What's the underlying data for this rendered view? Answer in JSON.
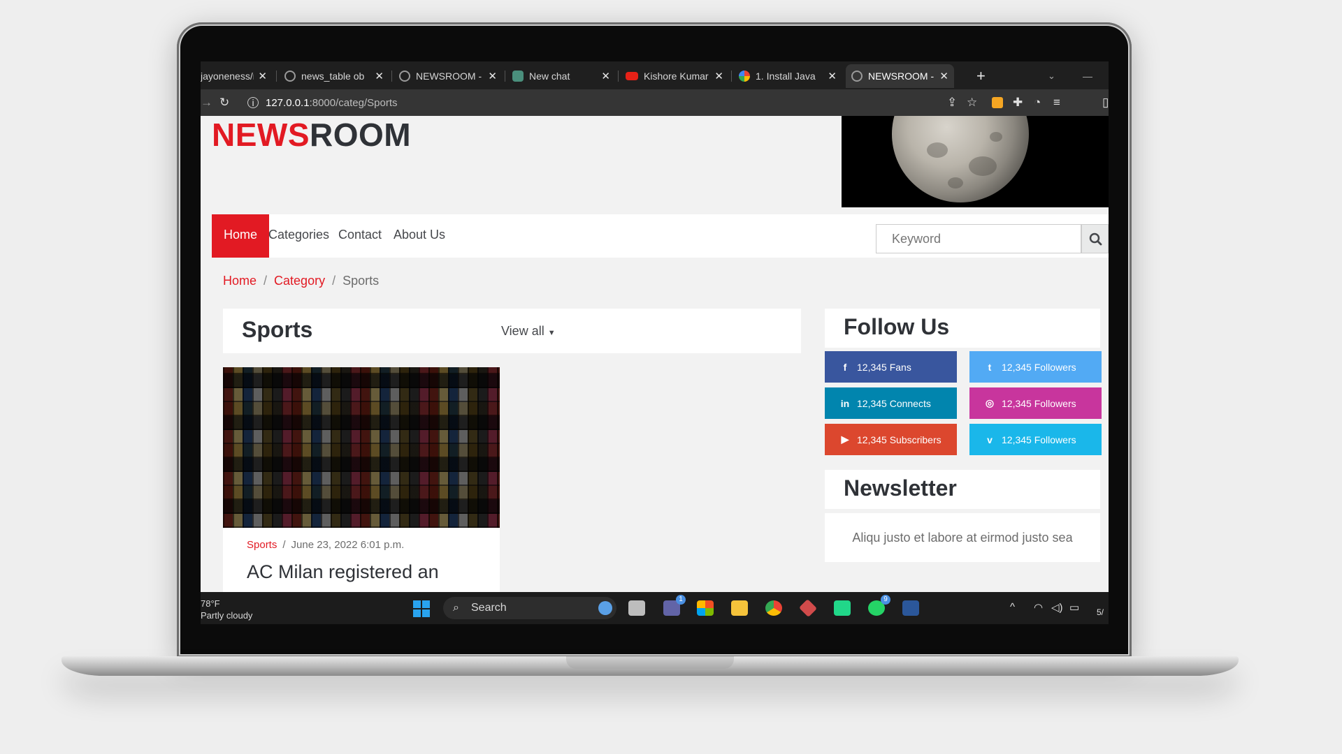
{
  "browser": {
    "tabs": [
      {
        "label": "jayoneness/n",
        "favicon": "github-icon"
      },
      {
        "label": "news_table ob",
        "favicon": "globe-icon"
      },
      {
        "label": "NEWSROOM -",
        "favicon": "globe-icon"
      },
      {
        "label": "New chat",
        "favicon": "chatgpt-icon"
      },
      {
        "label": "Kishore Kumar",
        "favicon": "youtube-icon"
      },
      {
        "label": "1. Install Java",
        "favicon": "google-icon"
      },
      {
        "label": "NEWSROOM -",
        "favicon": "globe-icon",
        "active": true
      }
    ],
    "new_tab": "+",
    "close": "✕",
    "address": {
      "host": "127.0.0.1",
      "path": ":8000/categ/Sports"
    }
  },
  "site": {
    "logo_red": "NEWS",
    "logo_dark": "ROOM",
    "nav": [
      "Home",
      "Categories",
      "Contact",
      "About Us"
    ],
    "search_placeholder": "Keyword",
    "breadcrumb": [
      "Home",
      "Category",
      "Sports"
    ],
    "section_title": "Sports",
    "view_all": "View all",
    "article": {
      "category": "Sports",
      "date": "June 23, 2022 6:01 p.m.",
      "title": "AC Milan registered an"
    },
    "follow_title": "Follow Us",
    "social": [
      {
        "icon": "f",
        "name": "facebook-icon",
        "label": "12,345 Fans",
        "color": "#39569e"
      },
      {
        "icon": "t",
        "name": "twitter-icon",
        "label": "12,345 Followers",
        "color": "#52aaf4"
      },
      {
        "icon": "in",
        "name": "linkedin-icon",
        "label": "12,345 Connects",
        "color": "#0185ae"
      },
      {
        "icon": "◎",
        "name": "instagram-icon",
        "label": "12,345 Followers",
        "color": "#c8359d"
      },
      {
        "icon": "▶",
        "name": "youtube-icon",
        "label": "12,345 Subscribers",
        "color": "#dc472e"
      },
      {
        "icon": "v",
        "name": "vimeo-icon",
        "label": "12,345 Followers",
        "color": "#1ab7ea"
      }
    ],
    "newsletter_title": "Newsletter",
    "newsletter_text": "Aliqu justo et labore at eirmod justo sea"
  },
  "taskbar": {
    "temp": "78°F",
    "weather": "Partly cloudy",
    "search": "Search",
    "teams_badge": "1",
    "whatsapp_badge": "9",
    "clock_partial": "5/"
  },
  "colors": {
    "brand_red": "#e21a23",
    "dark_text": "#2f3237"
  }
}
